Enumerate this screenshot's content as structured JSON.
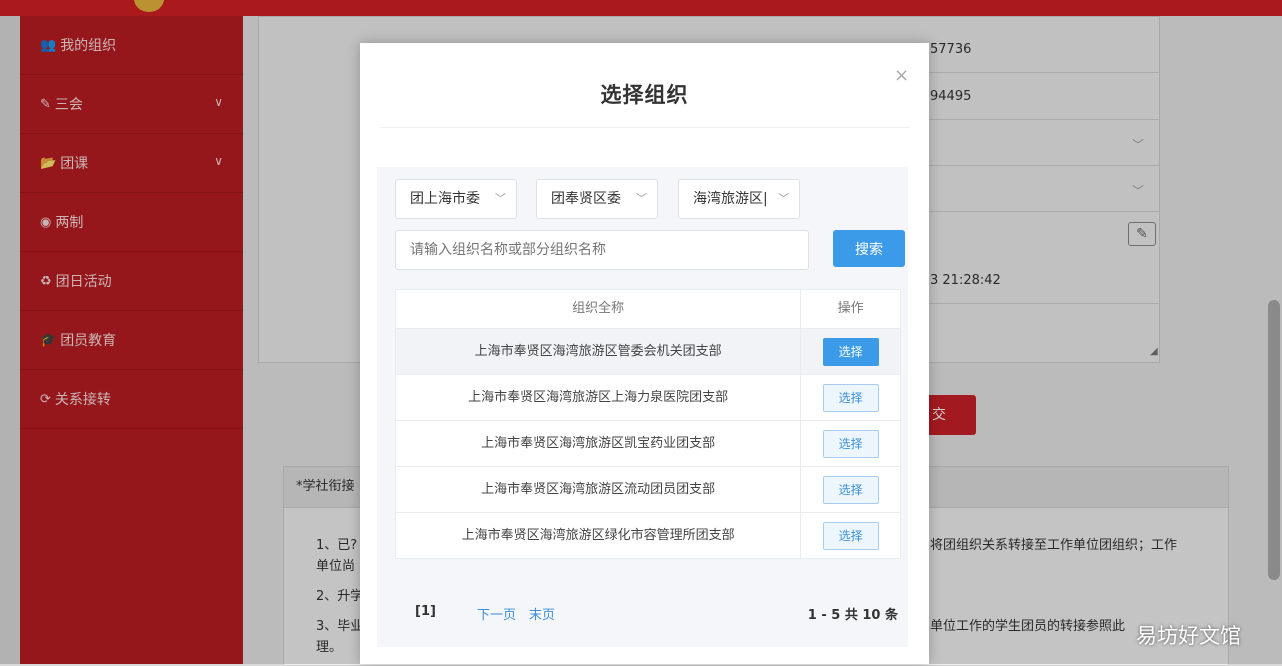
{
  "sidebar": {
    "items": [
      {
        "icon": "users-icon",
        "glyph": "👥",
        "label": "我的组织"
      },
      {
        "icon": "edit-icon",
        "glyph": "✎",
        "label": "三会",
        "chevron": "∨"
      },
      {
        "icon": "folder-icon",
        "glyph": "📂",
        "label": "团课",
        "chevron": "∨"
      },
      {
        "icon": "target-icon",
        "glyph": "◉",
        "label": "两制"
      },
      {
        "icon": "recycle-icon",
        "glyph": "♻",
        "label": "团日活动"
      },
      {
        "icon": "graduation-cap-icon",
        "glyph": "🎓",
        "label": "团员教育"
      },
      {
        "icon": "refresh-icon",
        "glyph": "⟳",
        "label": "关系接转"
      }
    ]
  },
  "background": {
    "row1": "57736",
    "row2": "94495",
    "row6": "3 21:28:42",
    "submit_fragment": "交",
    "notice_title": "*学社衔接",
    "notice_line1": "1、已?",
    "notice_line1_right": "将团组织关系转接至工作单位团组织；工作",
    "notice_line2": "单位尚",
    "notice_line3": "2、升学",
    "notice_line4": "3、毕业",
    "notice_line4_right": "单位工作的学生团员的转接参照此",
    "notice_line5": "理。"
  },
  "modal": {
    "title": "选择组织",
    "close_label": "×",
    "filters": [
      {
        "value": "团上海市委",
        "chevron": "﹀"
      },
      {
        "value": "团奉贤区委",
        "chevron": "﹀"
      },
      {
        "value": "海湾旅游区|",
        "chevron": "﹀"
      }
    ],
    "search_placeholder": "请输入组织名称或部分组织名称",
    "search_button": "搜索",
    "table": {
      "header_name": "组织全称",
      "header_action": "操作",
      "rows": [
        {
          "name": "上海市奉贤区海湾旅游区管委会机关团支部",
          "action": "选择"
        },
        {
          "name": "上海市奉贤区海湾旅游区上海力泉医院团支部",
          "action": "选择"
        },
        {
          "name": "上海市奉贤区海湾旅游区凯宝药业团支部",
          "action": "选择"
        },
        {
          "name": "上海市奉贤区海湾旅游区流动团员团支部",
          "action": "选择"
        },
        {
          "name": "上海市奉贤区海湾旅游区绿化市容管理所团支部",
          "action": "选择"
        }
      ]
    },
    "pager": {
      "current": "[1]",
      "next": "下一页",
      "last": "末页",
      "total": "1 - 5  共 10 条"
    }
  },
  "watermark": "易坊好文馆",
  "colors": {
    "brand_red": "#d01f22",
    "accent_blue": "#3c9be8"
  }
}
